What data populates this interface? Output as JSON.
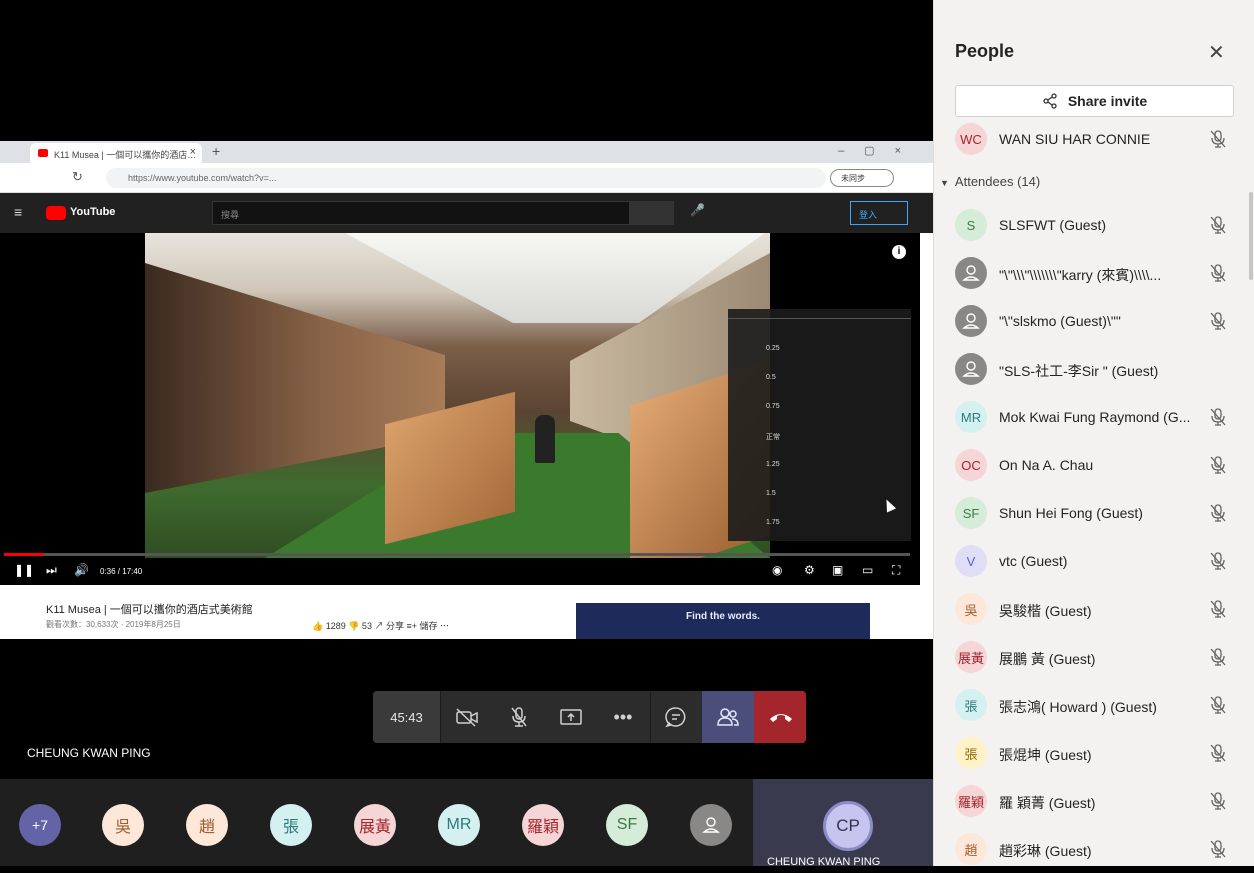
{
  "shared_screen": {
    "browser": {
      "tab_title": "K11 Musea | 一個可以攜你的酒店…",
      "url": "https://www.youtube.com/watch?v=...",
      "pill_label": "未同步"
    },
    "youtube": {
      "logo_text": "YouTube",
      "search_placeholder": "搜尋",
      "signin_label": "登入",
      "time": "0:36 / 17:40",
      "progress_fraction": 0.044,
      "speed_options": [
        "0.25",
        "0.5",
        "0.75",
        "正常",
        "1.25",
        "1.5",
        "1.75"
      ],
      "video_title": "K11 Musea | 一個可以攜你的酒店式美術館",
      "video_meta": "觀看次數：30,633次 · 2019年8月25日",
      "actions": "👍 1289   👎 53   ↗ 分享   ≡+ 儲存   ⋯",
      "ad_text": "Find the words."
    }
  },
  "call_controls": {
    "timer": "45:43"
  },
  "speaker_name": "CHEUNG KWAN PING",
  "strip": {
    "overflow": "+7",
    "avatars": [
      {
        "initials": "吳",
        "bg": "#fde7d9",
        "fg": "#a15c2d"
      },
      {
        "initials": "趙",
        "bg": "#fde7d9",
        "fg": "#a15c2d"
      },
      {
        "initials": "張",
        "bg": "#d5f0f0",
        "fg": "#2b7a7a"
      },
      {
        "initials": "展黃",
        "bg": "#f5d5d5",
        "fg": "#a4262c"
      },
      {
        "initials": "MR",
        "bg": "#d5f0f0",
        "fg": "#2b7a7a"
      },
      {
        "initials": "羅穎",
        "bg": "#f5d5d5",
        "fg": "#a4262c"
      },
      {
        "initials": "SF",
        "bg": "#d5ecd8",
        "fg": "#3b7a45"
      },
      {
        "initials": "",
        "bg": "#8a8886",
        "fg": "#fff"
      }
    ],
    "self": {
      "initials": "CP",
      "name": "CHEUNG KWAN PING"
    }
  },
  "people": {
    "title": "People",
    "share_label": "Share invite",
    "organizer": {
      "initials": "WC",
      "name": "WAN SIU HAR CONNIE",
      "bg": "#f5d5d5",
      "fg": "#a4262c"
    },
    "attendees_label": "Attendees (14)",
    "attendees": [
      {
        "initials": "S",
        "name": "SLSFWT (Guest)",
        "bg": "#d5ecd8",
        "fg": "#3b7a45",
        "muted": true
      },
      {
        "initials": "",
        "name": "\"\\\"\\\\\\\"\\\\\\\\\\\\\\\"karry (來賓)\\\\\\\\...",
        "bg": "#8a8886",
        "fg": "#fff",
        "muted": true
      },
      {
        "initials": "",
        "name": "\"\\\"slskmo (Guest)\\\"\"",
        "bg": "#8a8886",
        "fg": "#fff",
        "muted": true
      },
      {
        "initials": "",
        "name": "\"SLS-社工-李Sir \" (Guest)",
        "bg": "#8a8886",
        "fg": "#fff",
        "muted": false
      },
      {
        "initials": "MR",
        "name": "Mok Kwai Fung Raymond (G...",
        "bg": "#d5f0f0",
        "fg": "#2b7a7a",
        "muted": true
      },
      {
        "initials": "OC",
        "name": "On Na A. Chau",
        "bg": "#f5d5d5",
        "fg": "#a4262c",
        "muted": true
      },
      {
        "initials": "SF",
        "name": "Shun Hei Fong (Guest)",
        "bg": "#d5ecd8",
        "fg": "#3b7a45",
        "muted": true
      },
      {
        "initials": "V",
        "name": "vtc (Guest)",
        "bg": "#e0def7",
        "fg": "#5b5fc7",
        "muted": true
      },
      {
        "initials": "吳",
        "name": "吳駿楷 (Guest)",
        "bg": "#fde7d9",
        "fg": "#a15c2d",
        "muted": true
      },
      {
        "initials": "展黃",
        "name": "展鵬 黃 (Guest)",
        "bg": "#f5d5d5",
        "fg": "#a4262c",
        "muted": true
      },
      {
        "initials": "張",
        "name": "張志鴻( Howard ) (Guest)",
        "bg": "#d5f0f0",
        "fg": "#2b7a7a",
        "muted": true
      },
      {
        "initials": "張",
        "name": "張焜坤 (Guest)",
        "bg": "#fff1c8",
        "fg": "#8a6a00",
        "muted": true
      },
      {
        "initials": "羅穎",
        "name": "羅 穎菁 (Guest)",
        "bg": "#f5d5d5",
        "fg": "#a4262c",
        "muted": true
      },
      {
        "initials": "趙",
        "name": "趙彩琳 (Guest)",
        "bg": "#fde7d9",
        "fg": "#a15c2d",
        "muted": true
      }
    ]
  }
}
